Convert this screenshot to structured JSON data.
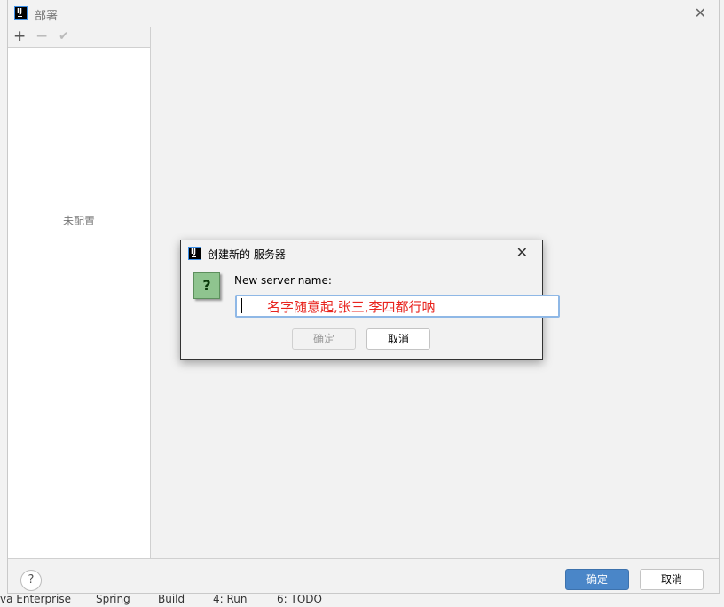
{
  "window": {
    "title": "部署",
    "close_icon": "close-icon"
  },
  "toolbar": {
    "add": "+",
    "remove": "−",
    "apply": "✔"
  },
  "left_panel": {
    "empty_text": "未配置"
  },
  "footer": {
    "help": "?",
    "ok": "确定",
    "cancel": "取消"
  },
  "dialog": {
    "title": "创建新的 服务器",
    "label": "New server name:",
    "input_value": "名字随意起,张三,李四都行呐",
    "icon": "question-icon",
    "question": "?",
    "ok": "确定",
    "cancel": "取消"
  },
  "ide_status": {
    "items": [
      "va Enterprise",
      "Spring",
      "Build",
      "4: Run",
      "6: TODO"
    ]
  },
  "colors": {
    "primary": "#4a86c8",
    "input_text": "#e8251f"
  }
}
